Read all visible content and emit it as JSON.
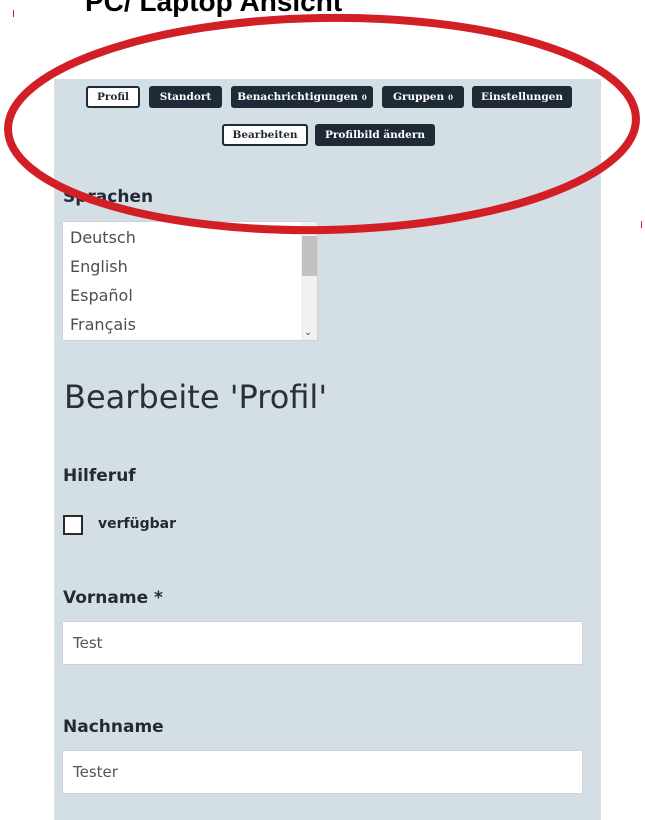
{
  "caption": "PC/ Laptop Ansicht",
  "nav": {
    "profil": "Profil",
    "standort": "Standort",
    "benachrichtigungen": "Benachrichtigungen",
    "benachrichtigungen_count": "0",
    "gruppen": "Gruppen",
    "gruppen_count": "0",
    "einstellungen": "Einstellungen",
    "bearbeiten": "Bearbeiten",
    "profilbild": "Profilbild ändern"
  },
  "sprachen": {
    "heading": "Sprachen",
    "options": [
      "Deutsch",
      "English",
      "Español",
      "Français"
    ]
  },
  "form": {
    "title": "Bearbeite 'Profil'",
    "hilferuf_heading": "Hilferuf",
    "verfuegbar_label": "verfügbar",
    "vorname_label": "Vorname *",
    "vorname_value": "Test",
    "nachname_label": "Nachname",
    "nachname_value": "Tester"
  },
  "colors": {
    "panel_bg": "#d3dfe5",
    "button_dark": "#1f2a37",
    "annotation_red": "#d21f26"
  }
}
